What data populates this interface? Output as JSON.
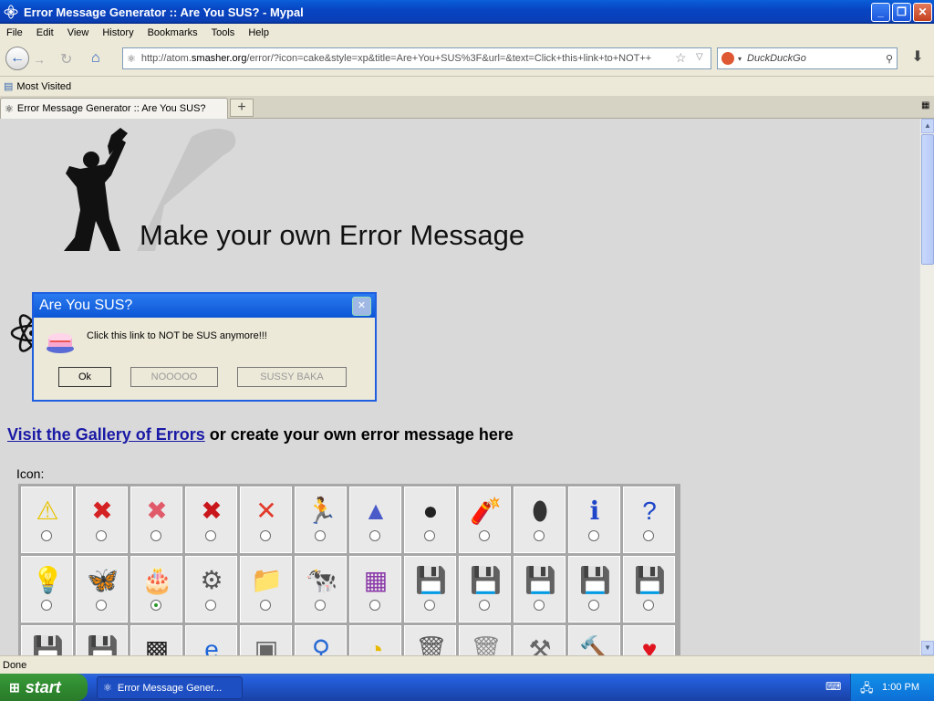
{
  "window": {
    "title": "Error Message Generator :: Are You SUS? - Mypal"
  },
  "menu": [
    "File",
    "Edit",
    "View",
    "History",
    "Bookmarks",
    "Tools",
    "Help"
  ],
  "nav": {
    "url_prefix": "http://atom.",
    "url_domain": "smasher.org",
    "url_rest": "/error/?icon=cake&style=xp&title=Are+You+SUS%3F&url=&text=Click+this+link+to+NOT++",
    "search_placeholder": "DuckDuckGo"
  },
  "bookmarks": {
    "most_visited": "Most Visited"
  },
  "tabs": [
    {
      "label": "Error Message Generator :: Are You SUS?"
    }
  ],
  "page": {
    "heading": "Make your own Error Message",
    "visit_link": "Visit the Gallery of Errors",
    "visit_rest": " or create your own error message here",
    "icon_label": "Icon:"
  },
  "dialog": {
    "title": "Are You SUS?",
    "message": "Click this link to NOT be SUS anymore!!!",
    "buttons": [
      "Ok",
      "NOOOOO",
      "SUSSY BAKA"
    ]
  },
  "icons": [
    {
      "name": "warning-icon",
      "selected": false
    },
    {
      "name": "error-red-circle-icon",
      "selected": false
    },
    {
      "name": "error-pink-circle-icon",
      "selected": false
    },
    {
      "name": "error-xp-icon",
      "selected": false
    },
    {
      "name": "red-x-icon",
      "selected": false
    },
    {
      "name": "aim-man-icon",
      "selected": false
    },
    {
      "name": "triangle-icon",
      "selected": false
    },
    {
      "name": "bomb-icon",
      "selected": false
    },
    {
      "name": "dynamite-icon",
      "selected": false
    },
    {
      "name": "grenade-icon",
      "selected": false
    },
    {
      "name": "info-icon",
      "selected": false
    },
    {
      "name": "question-icon",
      "selected": false
    },
    {
      "name": "lightbulb-icon",
      "selected": false
    },
    {
      "name": "msn-butterfly-icon",
      "selected": false
    },
    {
      "name": "cake-icon",
      "selected": true
    },
    {
      "name": "saw-blade-icon",
      "selected": false
    },
    {
      "name": "folder-tools-icon",
      "selected": false
    },
    {
      "name": "cow-icon",
      "selected": false
    },
    {
      "name": "winrar-icon",
      "selected": false
    },
    {
      "name": "floppy-blue-icon",
      "selected": false
    },
    {
      "name": "floppy-white-icon",
      "selected": false
    },
    {
      "name": "floppy-orange-icon",
      "selected": false
    },
    {
      "name": "floppy-red-icon",
      "selected": false
    },
    {
      "name": "floppy-beige-icon",
      "selected": false
    },
    {
      "name": "floppy-gray-icon",
      "selected": false
    },
    {
      "name": "floppy-yellow-icon",
      "selected": false
    },
    {
      "name": "msdos-icon",
      "selected": false
    },
    {
      "name": "ie-icon",
      "selected": false
    },
    {
      "name": "windows-stack-icon",
      "selected": false
    },
    {
      "name": "magnifier-icon",
      "selected": false
    },
    {
      "name": "pacman-icon",
      "selected": false
    },
    {
      "name": "trash-icon",
      "selected": false
    },
    {
      "name": "trash-full-icon",
      "selected": false
    },
    {
      "name": "tools-icon",
      "selected": false
    },
    {
      "name": "hammer-icon",
      "selected": false
    },
    {
      "name": "heart-icon",
      "selected": false
    }
  ],
  "status": {
    "text": "Done"
  },
  "taskbar": {
    "start": "start",
    "item": "Error Message Gener...",
    "clock": "1:00 PM"
  }
}
